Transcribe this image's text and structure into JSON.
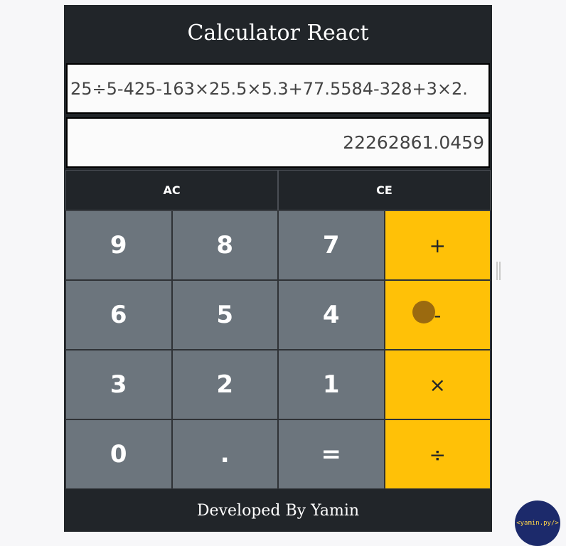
{
  "app": {
    "title": "Calculator React",
    "footer": "Developed By Yamin"
  },
  "display": {
    "expression": "25÷5-425-163×25.5×5.3+77.5584-328+3×2.",
    "result": "22262861.0459"
  },
  "controls": [
    {
      "label": "AC",
      "name": "ac-button"
    },
    {
      "label": "CE",
      "name": "ce-button"
    }
  ],
  "keys": [
    {
      "label": "9",
      "name": "key-9",
      "type": "digit"
    },
    {
      "label": "8",
      "name": "key-8",
      "type": "digit"
    },
    {
      "label": "7",
      "name": "key-7",
      "type": "digit"
    },
    {
      "label": "+",
      "name": "key-plus",
      "type": "op"
    },
    {
      "label": "6",
      "name": "key-6",
      "type": "digit"
    },
    {
      "label": "5",
      "name": "key-5",
      "type": "digit"
    },
    {
      "label": "4",
      "name": "key-4",
      "type": "digit"
    },
    {
      "label": "-",
      "name": "key-minus",
      "type": "op"
    },
    {
      "label": "3",
      "name": "key-3",
      "type": "digit"
    },
    {
      "label": "2",
      "name": "key-2",
      "type": "digit"
    },
    {
      "label": "1",
      "name": "key-1",
      "type": "digit"
    },
    {
      "label": "×",
      "name": "key-multiply",
      "type": "op"
    },
    {
      "label": "0",
      "name": "key-0",
      "type": "digit"
    },
    {
      "label": ".",
      "name": "key-decimal",
      "type": "digit"
    },
    {
      "label": "=",
      "name": "key-equals",
      "type": "digit"
    },
    {
      "label": "÷",
      "name": "key-divide",
      "type": "op"
    }
  ],
  "badge": {
    "text": "<yamin.py/>"
  },
  "colors": {
    "dark": "#212529",
    "digit": "#6c757d",
    "operator": "#ffc107"
  }
}
